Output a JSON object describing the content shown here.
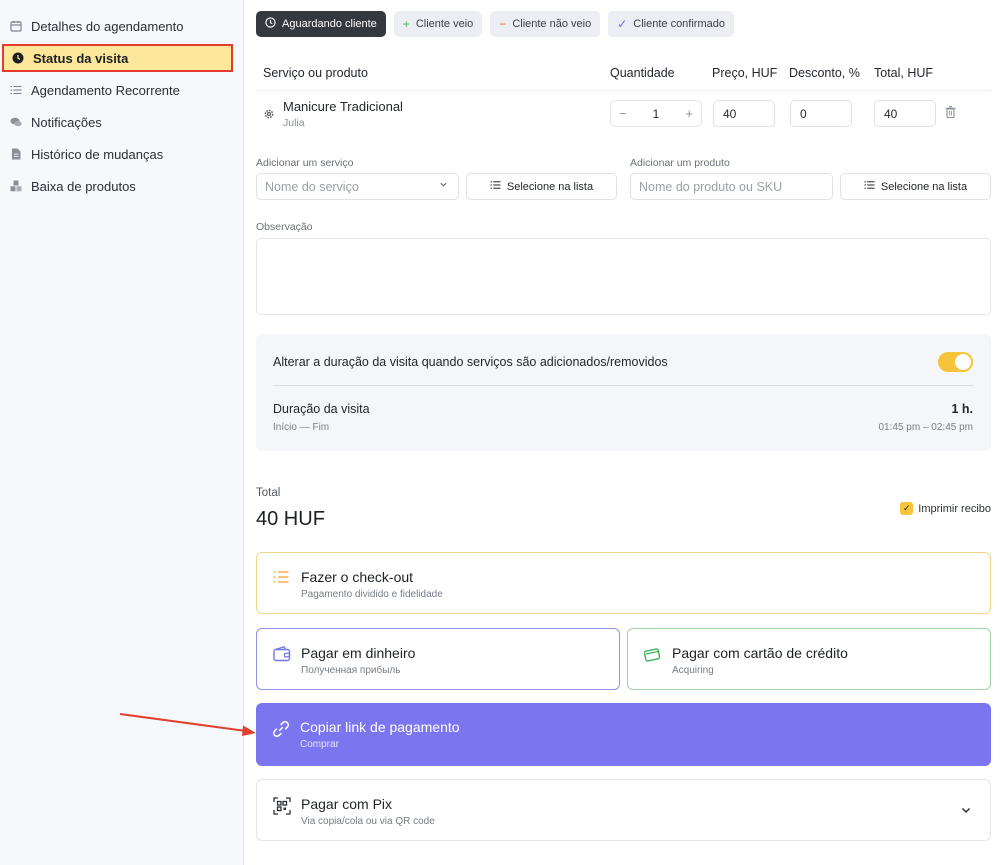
{
  "sidebar": {
    "items": [
      {
        "label": "Detalhes do agendamento",
        "icon": "calendar-icon"
      },
      {
        "label": "Status da visita",
        "icon": "clock-icon",
        "active": true
      },
      {
        "label": "Agendamento Recorrente",
        "icon": "list-icon"
      },
      {
        "label": "Notificações",
        "icon": "chat-icon"
      },
      {
        "label": "Histórico de mudanças",
        "icon": "document-icon"
      },
      {
        "label": "Baixa de produtos",
        "icon": "boxes-icon"
      }
    ]
  },
  "status": {
    "waiting": "Aguardando cliente",
    "came": "Cliente veio",
    "not_came": "Cliente não veio",
    "confirmed": "Cliente confirmado"
  },
  "table": {
    "headers": {
      "service": "Serviço ou produto",
      "qty": "Quantidade",
      "price": "Preço, HUF",
      "discount": "Desconto, %",
      "total": "Total, HUF"
    },
    "rows": [
      {
        "name": "Manicure Tradicional",
        "staff": "Julia",
        "qty": "1",
        "price": "40",
        "discount": "0",
        "total": "40"
      }
    ]
  },
  "add_service": {
    "label": "Adicionar um serviço",
    "placeholder": "Nome do serviço",
    "button": "Selecione na lista"
  },
  "add_product": {
    "label": "Adicionar um produto",
    "placeholder": "Nome do produto ou SKU",
    "button": "Selecione na lista"
  },
  "note": {
    "label": "Observação"
  },
  "duration": {
    "toggle_label": "Alterar a duração da visita quando serviços são adicionados/removidos",
    "toggle_on": true,
    "title": "Duração da visita",
    "subtitle": "Início — Fim",
    "value": "1 h.",
    "time_range": "01:45 pm – 02:45 pm"
  },
  "total": {
    "label": "Total",
    "value": "40 HUF",
    "print_label": "Imprimir recibo",
    "print_checked": true
  },
  "cards": {
    "checkout": {
      "title": "Fazer o check-out",
      "subtitle": "Pagamento dividido e fidelidade"
    },
    "cash": {
      "title": "Pagar em dinheiro",
      "subtitle": "Полученная прибыль"
    },
    "credit": {
      "title": "Pagar com cartão de crédito",
      "subtitle": "Acquiring"
    },
    "link": {
      "title": "Copiar link de pagamento",
      "subtitle": "Comprar"
    },
    "pix": {
      "title": "Pagar com Pix",
      "subtitle": "Via copia/cola ou via QR code"
    }
  },
  "colors": {
    "accent_yellow": "#f5c43b",
    "highlight_border": "#e53b2f",
    "purple": "#7b75f0",
    "checkout_border": "#f3d58a",
    "cash_border": "#8c93e8",
    "credit_border": "#9fd6a4"
  }
}
